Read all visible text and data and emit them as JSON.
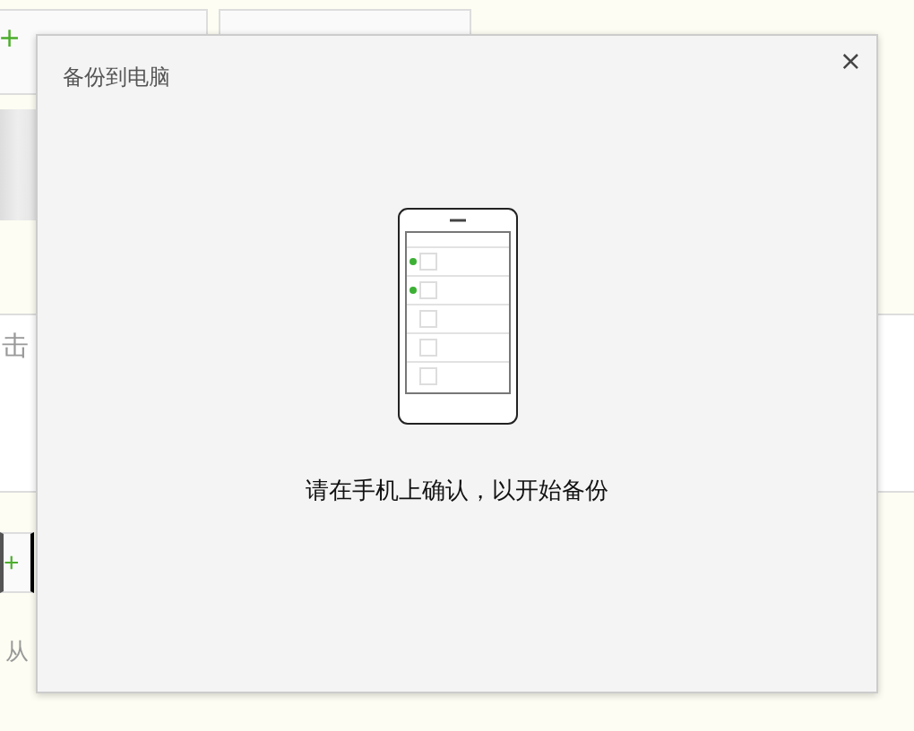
{
  "background": {
    "top_button_icon": "+",
    "panel_text": "击",
    "add_row_icon": "+",
    "footer_text": "从"
  },
  "dialog": {
    "title": "备份到电脑",
    "close": "×",
    "message": "请在手机上确认，以开始备份"
  }
}
